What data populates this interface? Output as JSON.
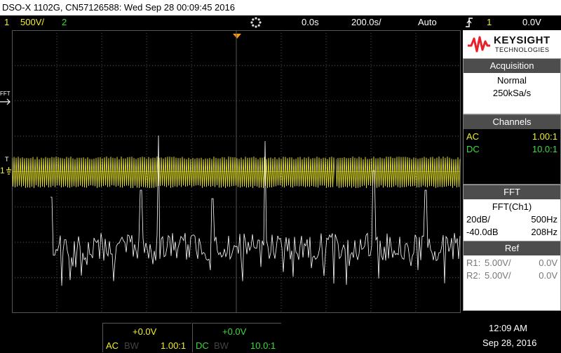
{
  "title": "DSO-X 1102G, CN57126588: Wed Sep 28 00:09:45 2016",
  "status": {
    "ch1_num": "1",
    "ch1_scale": "500 Ε/",
    "ch1_scale_text": "500",
    "ch2_num": "2",
    "acq_icon": "acquire-running-icon",
    "time_offset": "0.0s",
    "time_scale": "200.0 s/",
    "time_scale_text": "200.0",
    "trigger_mode": "Auto",
    "trigger_icon": "trigger-edge-icon",
    "trigger_ch": "1",
    "trigger_level": "0.0V"
  },
  "markers": {
    "fft": "FFT",
    "trigger": "T",
    "ch1": "1"
  },
  "brand": {
    "name": "KEYSIGHT",
    "sub": "TECHNOLOGIES",
    "color": "#e8202a"
  },
  "acquisition": {
    "header": "Acquisition",
    "mode": "Normal",
    "rate": "250kSa/s"
  },
  "channels": {
    "header": "Channels",
    "rows": [
      {
        "coupling": "AC",
        "probe": "1.00:1",
        "color": "#f2ee2a"
      },
      {
        "coupling": "DC",
        "probe": "10.0:1",
        "color": "#3fd93f"
      }
    ]
  },
  "fft": {
    "header": "FFT",
    "source": "FFT(Ch1)",
    "scale": "20dB/",
    "span": "500Hz",
    "offset": "-40.0dB",
    "center": "208Hz"
  },
  "ref": {
    "header": "Ref",
    "rows": [
      {
        "label": "R1:",
        "scale": "5.00V/",
        "offset": "0.0V"
      },
      {
        "label": "R2:",
        "scale": "5.00V/",
        "offset": "0.0V"
      }
    ]
  },
  "bottom": {
    "ch1": {
      "offset": "+0.0V",
      "coupling": "AC",
      "bw": "BW",
      "probe": "1.00:1"
    },
    "ch2": {
      "offset": "+0.0V",
      "coupling": "DC",
      "bw": "BW",
      "probe": "10.0:1"
    },
    "time": "12:09 AM",
    "date": "Sep 28, 2016"
  },
  "colors": {
    "ch1": "#f2ee2a",
    "ch2": "#3fd93f",
    "fft_trace": "#ffffff",
    "grid": "#555555",
    "trigger_marker": "#f39c12"
  }
}
